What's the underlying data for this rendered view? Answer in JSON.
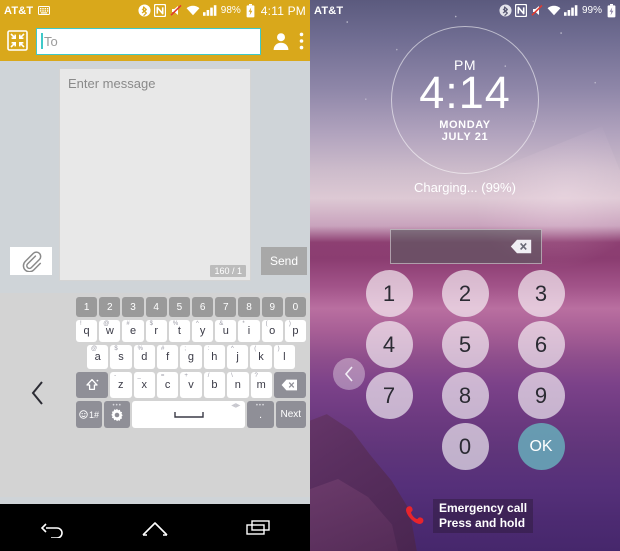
{
  "left_panel": {
    "statusbar": {
      "carrier": "AT&T",
      "battery_percent": "98%",
      "time": "4:11 PM",
      "icons": [
        "keyboard-icon",
        "bluetooth-icon",
        "nfc-icon",
        "mute-icon",
        "wifi-icon",
        "signal-icon",
        "battery-charging-icon"
      ]
    },
    "appbar": {
      "collapse_icon": "collapse-arrows-icon",
      "to_value": "",
      "to_placeholder": "To",
      "contacts_icon": "contact-person-icon",
      "overflow_icon": "overflow-menu-icon",
      "bg_color": "#d9a81b"
    },
    "compose": {
      "message_placeholder": "Enter message",
      "message_value": "",
      "char_counter": "160 / 1",
      "attach_icon": "paperclip-icon",
      "send_label": "Send"
    },
    "keyboard": {
      "resize_icon": "chevron-left-icon",
      "number_row": [
        "1",
        "2",
        "3",
        "4",
        "5",
        "6",
        "7",
        "8",
        "9",
        "0"
      ],
      "row_q": [
        {
          "key": "q",
          "sup": "!"
        },
        {
          "key": "w",
          "sup": "@"
        },
        {
          "key": "e",
          "sup": "#"
        },
        {
          "key": "r",
          "sup": "$"
        },
        {
          "key": "t",
          "sup": "%"
        },
        {
          "key": "y",
          "sup": "^"
        },
        {
          "key": "u",
          "sup": "&"
        },
        {
          "key": "i",
          "sup": "*"
        },
        {
          "key": "o",
          "sup": "("
        },
        {
          "key": "p",
          "sup": ")"
        }
      ],
      "row_a": [
        {
          "key": "a",
          "sup": "@"
        },
        {
          "key": "s",
          "sup": "$"
        },
        {
          "key": "d",
          "sup": "%"
        },
        {
          "key": "f",
          "sup": "#"
        },
        {
          "key": "g",
          "sup": ";"
        },
        {
          "key": "h",
          "sup": ":"
        },
        {
          "key": "j",
          "sup": "^"
        },
        {
          "key": "k",
          "sup": "("
        },
        {
          "key": "l",
          "sup": ")"
        }
      ],
      "row_z": [
        {
          "key": "z",
          "sup": "-"
        },
        {
          "key": "x",
          "sup": "_"
        },
        {
          "key": "c",
          "sup": "="
        },
        {
          "key": "v",
          "sup": "+"
        },
        {
          "key": "b",
          "sup": "/"
        },
        {
          "key": "n",
          "sup": "\\"
        },
        {
          "key": "m",
          "sup": "?"
        }
      ],
      "shift_icon": "shift-arrow-icon",
      "backspace_icon": "backspace-icon",
      "symbols_label": "1#",
      "emoji_icon": "emoji-icon",
      "settings_icon": "gear-icon",
      "space_icon": "spacebar-icon",
      "period_label": ".",
      "next_label": "Next"
    },
    "navbar": {
      "back_icon": "back-arrow-icon",
      "home_icon": "home-icon",
      "recents_icon": "recents-icon"
    }
  },
  "right_panel": {
    "statusbar": {
      "carrier": "AT&T",
      "battery_percent": "99%",
      "icons": [
        "bluetooth-icon",
        "nfc-icon",
        "mute-icon",
        "wifi-icon",
        "signal-icon",
        "battery-charging-icon"
      ]
    },
    "clock": {
      "meridiem": "PM",
      "time": "4:14",
      "weekday": "MONDAY",
      "date": "JULY 21"
    },
    "charging_status": "Charging... (99%)",
    "pin_field": {
      "value": "",
      "backspace_icon": "backspace-icon"
    },
    "keypad": {
      "rows": [
        [
          "1",
          "2",
          "3"
        ],
        [
          "4",
          "5",
          "6"
        ],
        [
          "7",
          "8",
          "9"
        ],
        [
          "",
          "0",
          "OK"
        ]
      ],
      "ok_label": "OK",
      "ok_color": "#68a8b8"
    },
    "back_chevron_icon": "chevron-left-icon",
    "emergency": {
      "phone_icon": "phone-icon",
      "phone_color": "#e8242c",
      "line1": "Emergency call",
      "line2": "Press and hold"
    }
  }
}
